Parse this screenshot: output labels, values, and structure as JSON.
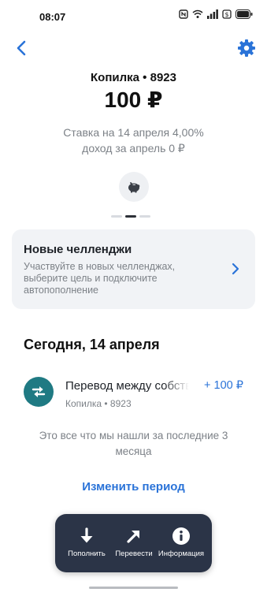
{
  "status_bar": {
    "time": "08:07"
  },
  "header": {
    "back_icon": "chevron-left-icon",
    "settings_icon": "gear-icon"
  },
  "account": {
    "name": "Копилка • 8923",
    "balance": "100 ₽",
    "rate": "Ставка на 14 апреля 4,00%",
    "income": "доход за апрель 0 ₽"
  },
  "carousel": {
    "pages": 3,
    "active_index": 1
  },
  "challenge": {
    "title": "Новые челленджи",
    "description": "Участвуйте в новых челленджах, выберите цель и подключите автопополнение"
  },
  "feed": {
    "date_heading": "Сегодня, 14 апреля",
    "transactions": [
      {
        "title": "Перевод между собственными счетами",
        "subtitle": "Копилка • 8923",
        "amount": "+ 100 ₽"
      }
    ],
    "empty_note": "Это все что мы нашли за последние 3 месяца",
    "change_period": "Изменить период"
  },
  "actions": [
    {
      "label": "Пополнить",
      "icon": "arrow-down-icon"
    },
    {
      "label": "Перевести",
      "icon": "arrow-up-right-icon"
    },
    {
      "label": "Информация",
      "icon": "info-icon"
    }
  ],
  "colors": {
    "accent": "#2a73d8",
    "transfer_icon_bg": "#1f7a83",
    "action_bar_bg": "#2b3447"
  }
}
